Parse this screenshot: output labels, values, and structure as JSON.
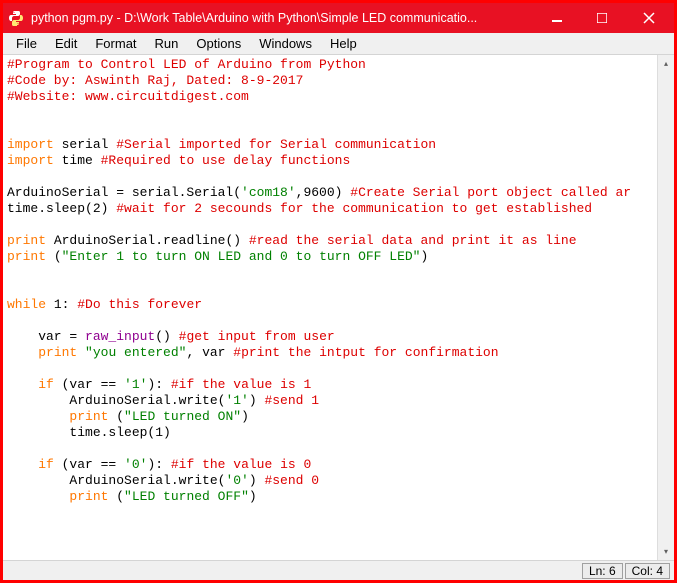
{
  "window": {
    "title": "python pgm.py - D:\\Work Table\\Arduino with Python\\Simple LED communicatio..."
  },
  "menu": {
    "file": "File",
    "edit": "Edit",
    "format": "Format",
    "run": "Run",
    "options": "Options",
    "windows": "Windows",
    "help": "Help"
  },
  "code": {
    "l01": "#Program to Control LED of Arduino from Python",
    "l02": "#Code by: Aswinth Raj, Dated: 8-9-2017",
    "l03": "#Website: www.circuitdigest.com",
    "l04a": "import",
    "l04b": " serial ",
    "l04c": "#Serial imported for Serial communication",
    "l05a": "import",
    "l05b": " time ",
    "l05c": "#Required to use delay functions",
    "l06a": "ArduinoSerial = serial.Serial(",
    "l06b": "'com18'",
    "l06c": ",9600) ",
    "l06d": "#Create Serial port object called ar",
    "l07a": "time.sleep(2) ",
    "l07b": "#wait for 2 secounds for the communication to get established",
    "l08a": "print",
    "l08b": " ArduinoSerial.readline() ",
    "l08c": "#read the serial data and print it as line",
    "l09a": "print",
    "l09b": " (",
    "l09c": "\"Enter 1 to turn ON LED and 0 to turn OFF LED\"",
    "l09d": ")",
    "l10a": "while",
    "l10b": " 1: ",
    "l10c": "#Do this forever",
    "l11a": "    var = ",
    "l11b": "raw_input",
    "l11c": "() ",
    "l11d": "#get input from user",
    "l12a": "    ",
    "l12b": "print",
    "l12c": " ",
    "l12d": "\"you entered\"",
    "l12e": ", var ",
    "l12f": "#print the intput for confirmation",
    "l13a": "    ",
    "l13b": "if",
    "l13c": " (var == ",
    "l13d": "'1'",
    "l13e": "): ",
    "l13f": "#if the value is 1",
    "l14a": "        ArduinoSerial.write(",
    "l14b": "'1'",
    "l14c": ") ",
    "l14d": "#send 1",
    "l15a": "        ",
    "l15b": "print",
    "l15c": " (",
    "l15d": "\"LED turned ON\"",
    "l15e": ")",
    "l16": "        time.sleep(1)",
    "l17a": "    ",
    "l17b": "if",
    "l17c": " (var == ",
    "l17d": "'0'",
    "l17e": "): ",
    "l17f": "#if the value is 0",
    "l18a": "        ArduinoSerial.write(",
    "l18b": "'0'",
    "l18c": ") ",
    "l18d": "#send 0",
    "l19a": "        ",
    "l19b": "print",
    "l19c": " (",
    "l19d": "\"LED turned OFF\"",
    "l19e": ")"
  },
  "status": {
    "ln": "Ln: 6",
    "col": "Col: 4"
  }
}
